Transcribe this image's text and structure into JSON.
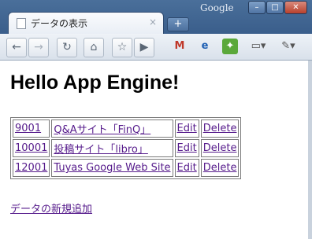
{
  "window": {
    "brand": "Google",
    "buttons": [
      "–",
      "□",
      "✕"
    ]
  },
  "tab": {
    "title": "データの表示",
    "close": "×"
  },
  "toolbar": {
    "icons": [
      "back-icon",
      "forward-icon",
      "reload-icon",
      "home-icon",
      "bookmark-star-icon",
      "play-icon",
      "gmail-icon",
      "ie-icon",
      "evernote-icon",
      "page-menu-icon",
      "wrench-menu-icon"
    ]
  },
  "page": {
    "heading": "Hello App Engine!",
    "rows": [
      {
        "id": "9001",
        "title": "Q&Aサイト「FinQ」",
        "edit": "Edit",
        "delete": "Delete"
      },
      {
        "id": "10001",
        "title": "投稿サイト「libro」",
        "edit": "Edit",
        "delete": "Delete"
      },
      {
        "id": "12001",
        "title": "Tuyas Google Web Site",
        "edit": "Edit",
        "delete": "Delete"
      }
    ],
    "new_link": "データの新規追加"
  }
}
